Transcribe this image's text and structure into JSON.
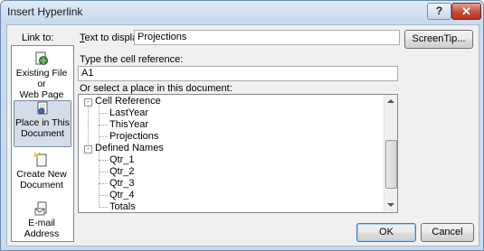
{
  "window": {
    "title": "Insert Hyperlink",
    "help_glyph": "?",
    "close_glyph": "✕"
  },
  "link_to": {
    "label": "Link to:",
    "items": [
      {
        "label_line1": "Existing File or",
        "label_line2": "Web Page",
        "icon": "globe-file-icon",
        "selected": false
      },
      {
        "label_line1": "Place in This",
        "label_line2": "Document",
        "icon": "document-place-icon",
        "selected": true
      },
      {
        "label_line1": "Create New",
        "label_line2": "Document",
        "icon": "new-document-icon",
        "selected": false
      },
      {
        "label_line1": "E-mail Address",
        "label_line2": "",
        "icon": "email-icon",
        "selected": false
      }
    ]
  },
  "text_to_display": {
    "label": "Text to display:",
    "value": "Projections"
  },
  "screentip_button": "ScreenTip...",
  "cell_reference": {
    "label": "Type the cell reference:",
    "value": "A1"
  },
  "place_list": {
    "label": "Or select a place in this document:",
    "tree": [
      {
        "label": "Cell Reference",
        "level": 0,
        "expander": "-"
      },
      {
        "label": "LastYear",
        "level": 1
      },
      {
        "label": "ThisYear",
        "level": 1
      },
      {
        "label": "Projections",
        "level": 1
      },
      {
        "label": "Defined Names",
        "level": 0,
        "expander": "-"
      },
      {
        "label": "Qtr_1",
        "level": 1
      },
      {
        "label": "Qtr_2",
        "level": 1
      },
      {
        "label": "Qtr_3",
        "level": 1
      },
      {
        "label": "Qtr_4",
        "level": 1
      },
      {
        "label": "Totals",
        "level": 1
      }
    ]
  },
  "buttons": {
    "ok": "OK",
    "cancel": "Cancel"
  }
}
